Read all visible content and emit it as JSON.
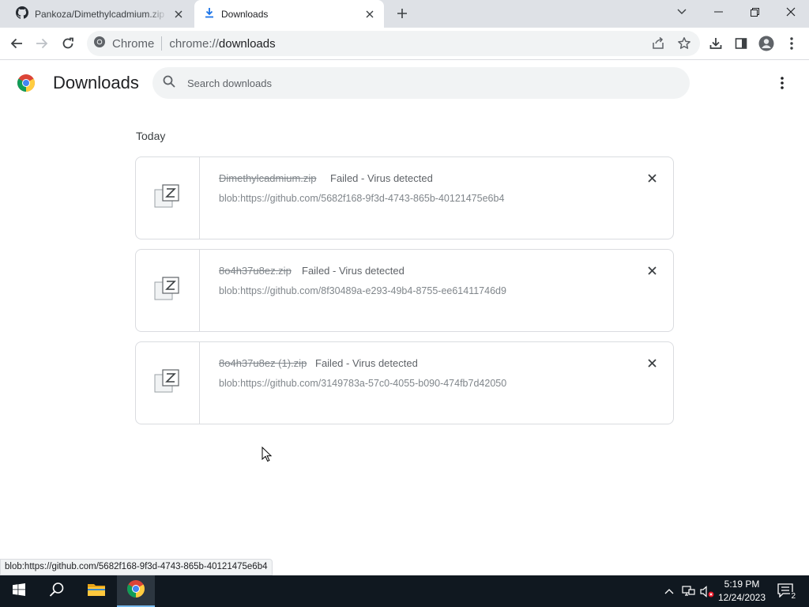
{
  "tabs": [
    {
      "title": "Pankoza/Dimethylcadmium.zip at",
      "icon": "github-icon"
    },
    {
      "title": "Downloads",
      "icon": "download-icon"
    }
  ],
  "toolbar": {
    "site_label": "Chrome",
    "url_prefix": "chrome://",
    "url_host": "downloads"
  },
  "page": {
    "title": "Downloads",
    "search_placeholder": "Search downloads"
  },
  "section_label": "Today",
  "downloads": [
    {
      "filename": "Dimethylcadmium.zip",
      "status": "Failed - Virus detected",
      "url": "blob:https://github.com/5682f168-9f3d-4743-865b-40121475e6b4"
    },
    {
      "filename": "8o4h37u8ez.zip",
      "status": "Failed - Virus detected",
      "url": "blob:https://github.com/8f30489a-e293-49b4-8755-ee61411746d9"
    },
    {
      "filename": "8o4h37u8ez (1).zip",
      "status": "Failed - Virus detected",
      "url": "blob:https://github.com/3149783a-57c0-4055-b090-474fb7d42050"
    }
  ],
  "status_bubble": "blob:https://github.com/5682f168-9f3d-4743-865b-40121475e6b4",
  "taskbar": {
    "time": "5:19 PM",
    "date": "12/24/2023",
    "notification_count": "2"
  },
  "colors": {
    "tabstrip": "#dee1e6",
    "accent_blue": "#1a73e8",
    "taskbar": "#101820"
  }
}
